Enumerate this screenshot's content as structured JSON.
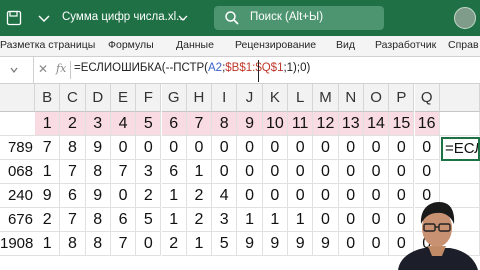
{
  "window": {
    "title": "Сумма цифр числа.xl...",
    "search_label": "Поиск (Alt+Ы)"
  },
  "ribbon": {
    "tabs": [
      "Разметка страницы",
      "Формулы",
      "Данные",
      "Рецензирование",
      "Вид",
      "Разработчик",
      "Справ"
    ]
  },
  "formula_bar": {
    "cancel_symbol": "✕",
    "fx_label": "fx",
    "formula_part1": "=ЕСЛИОШИБКА(--ПСТР(",
    "formula_ref_a": "A2",
    "formula_sep": ";",
    "formula_ref_b": "$B$1:$Q$1",
    "formula_part2": ";1);0)"
  },
  "sheet": {
    "columns": [
      "B",
      "C",
      "D",
      "E",
      "F",
      "G",
      "H",
      "I",
      "J",
      "K",
      "L",
      "M",
      "N",
      "O",
      "P",
      "Q"
    ],
    "header_row": [
      "1",
      "2",
      "3",
      "4",
      "5",
      "6",
      "7",
      "8",
      "9",
      "10",
      "11",
      "12",
      "13",
      "14",
      "15",
      "16"
    ],
    "left_col": [
      "",
      "789",
      "068",
      "240",
      "676",
      "1908"
    ],
    "rows": [
      [
        "7",
        "8",
        "9",
        "0",
        "0",
        "0",
        "0",
        "0",
        "0",
        "0",
        "0",
        "0",
        "0",
        "0",
        "0",
        "0"
      ],
      [
        "1",
        "7",
        "8",
        "7",
        "3",
        "6",
        "1",
        "0",
        "0",
        "0",
        "0",
        "0",
        "0",
        "0",
        "0",
        "0"
      ],
      [
        "9",
        "6",
        "9",
        "0",
        "2",
        "1",
        "2",
        "4",
        "0",
        "0",
        "0",
        "0",
        "0",
        "0",
        "0",
        "0"
      ],
      [
        "2",
        "7",
        "8",
        "6",
        "5",
        "1",
        "2",
        "3",
        "1",
        "1",
        "1",
        "0",
        "0",
        "0",
        "0",
        "0"
      ],
      [
        "1",
        "8",
        "8",
        "7",
        "0",
        "2",
        "1",
        "5",
        "9",
        "9",
        "9",
        "9",
        "0",
        "0",
        "0",
        "0"
      ]
    ],
    "active_cell_text": "=ЕСЛ"
  }
}
